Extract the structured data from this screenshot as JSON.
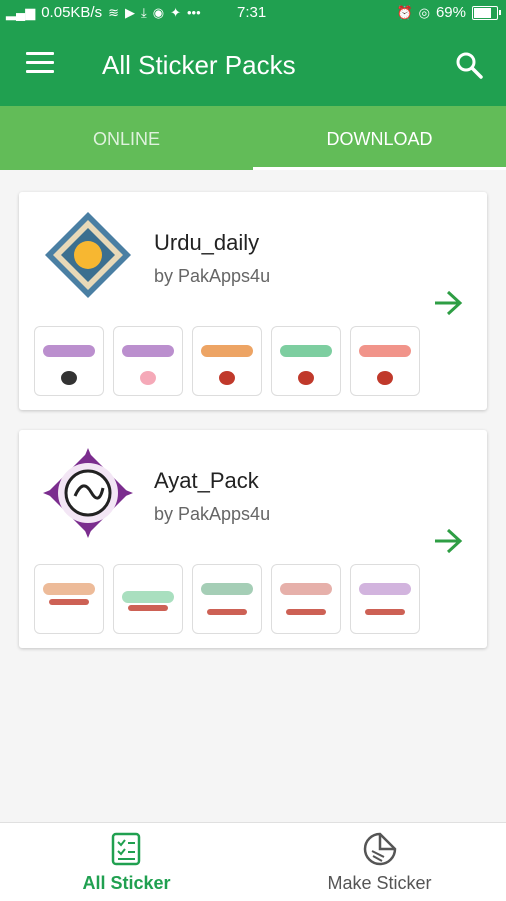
{
  "status": {
    "speed": "0.05KB/s",
    "time": "7:31",
    "battery": "69%",
    "battery_level": 0.69
  },
  "appbar": {
    "title": "All Sticker Packs",
    "menu_icon": "menu-icon",
    "search_icon": "search-icon"
  },
  "tabs": [
    {
      "label": "ONLINE",
      "active": false
    },
    {
      "label": "DOWNLOAD",
      "active": true
    }
  ],
  "packs": [
    {
      "name": "Urdu_daily",
      "author": "by PakApps4u",
      "thumb_count": 5
    },
    {
      "name": "Ayat_Pack",
      "author": "by PakApps4u",
      "thumb_count": 5
    }
  ],
  "bottom_nav": [
    {
      "label": "All Sticker",
      "active": true
    },
    {
      "label": "Make Sticker",
      "active": false
    }
  ],
  "colors": {
    "primary": "#20a050",
    "tabs": "#62bc58",
    "accent_arrow": "#2e9e44"
  }
}
